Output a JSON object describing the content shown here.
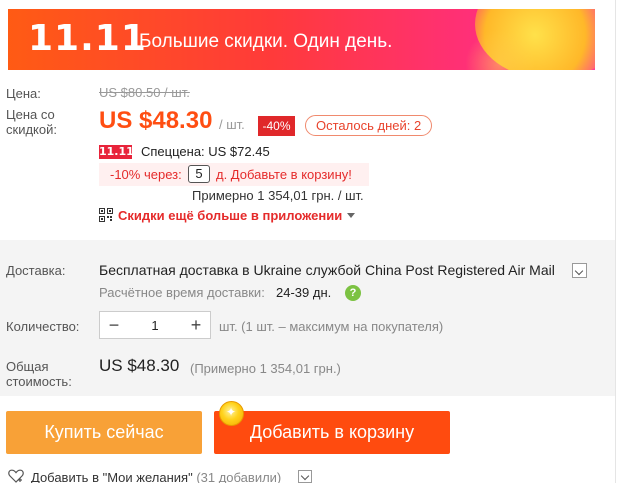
{
  "banner": {
    "logo": "11.11",
    "text": "Большие скидки. Один день."
  },
  "price": {
    "label": "Цена:",
    "old": "US $80.50 / шт.",
    "discount_label_line1": "Цена со",
    "discount_label_line2": "скидкой:",
    "current": "US $48.30",
    "unit": "/ шт.",
    "discount_badge": "-40%",
    "days_left": "Осталось дней: 2"
  },
  "special": {
    "logo": "11.11",
    "text": "Спеццена: US $72.45"
  },
  "promo": {
    "prefix": "-10% через:",
    "number": "5",
    "suffix": "д. Добавьте в корзину!"
  },
  "approx_price": "Примерно 1 354,01 грн. / шт.",
  "app_link": "Скидки ещё больше в приложении",
  "shipping": {
    "label": "Доставка:",
    "main": "Бесплатная доставка в Ukraine службой China Post Registered Air Mail",
    "eta_label": "Расчётное время доставки:",
    "eta_value": "24-39 дн.",
    "help_glyph": "?"
  },
  "quantity": {
    "label": "Количество:",
    "minus": "−",
    "value": "1",
    "plus": "+",
    "note": "шт. (1 шт. – максимум на покупателя)"
  },
  "total": {
    "label_line1": "Общая",
    "label_line2": "стоимость:",
    "value": "US $48.30",
    "approx": "(Примерно 1 354,01 грн.)"
  },
  "buttons": {
    "buy": "Купить сейчас",
    "cart": "Добавить в корзину"
  },
  "wishlist": {
    "text": "Добавить в \"Мои желания\"",
    "count": "(31 добавили)"
  },
  "colors": {
    "accent_orange": "#ff4b0f",
    "buy_button": "#f8a137",
    "discount_red": "#e0282a"
  }
}
